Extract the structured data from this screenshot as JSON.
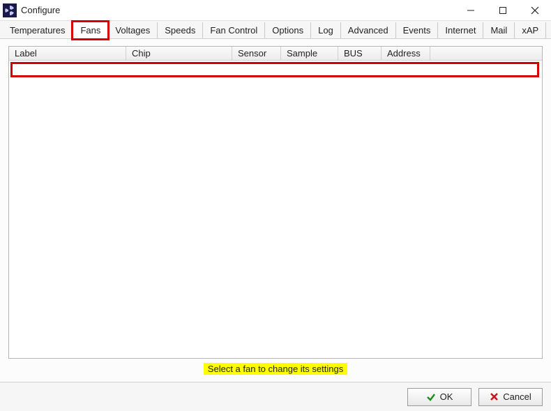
{
  "window": {
    "title": "Configure"
  },
  "tabs": [
    {
      "label": "Temperatures"
    },
    {
      "label": "Fans"
    },
    {
      "label": "Voltages"
    },
    {
      "label": "Speeds"
    },
    {
      "label": "Fan Control"
    },
    {
      "label": "Options"
    },
    {
      "label": "Log"
    },
    {
      "label": "Advanced"
    },
    {
      "label": "Events"
    },
    {
      "label": "Internet"
    },
    {
      "label": "Mail"
    },
    {
      "label": "xAP"
    }
  ],
  "active_tab_index": 1,
  "highlight_tab_index": 1,
  "columns": {
    "label": "Label",
    "chip": "Chip",
    "sensor": "Sensor",
    "sample": "Sample",
    "bus": "BUS",
    "address": "Address"
  },
  "rows": [],
  "hint": "Select a fan to change its settings",
  "buttons": {
    "ok": "OK",
    "cancel": "Cancel"
  },
  "colors": {
    "highlight": "#d50000",
    "hint_bg": "#ffff00"
  }
}
